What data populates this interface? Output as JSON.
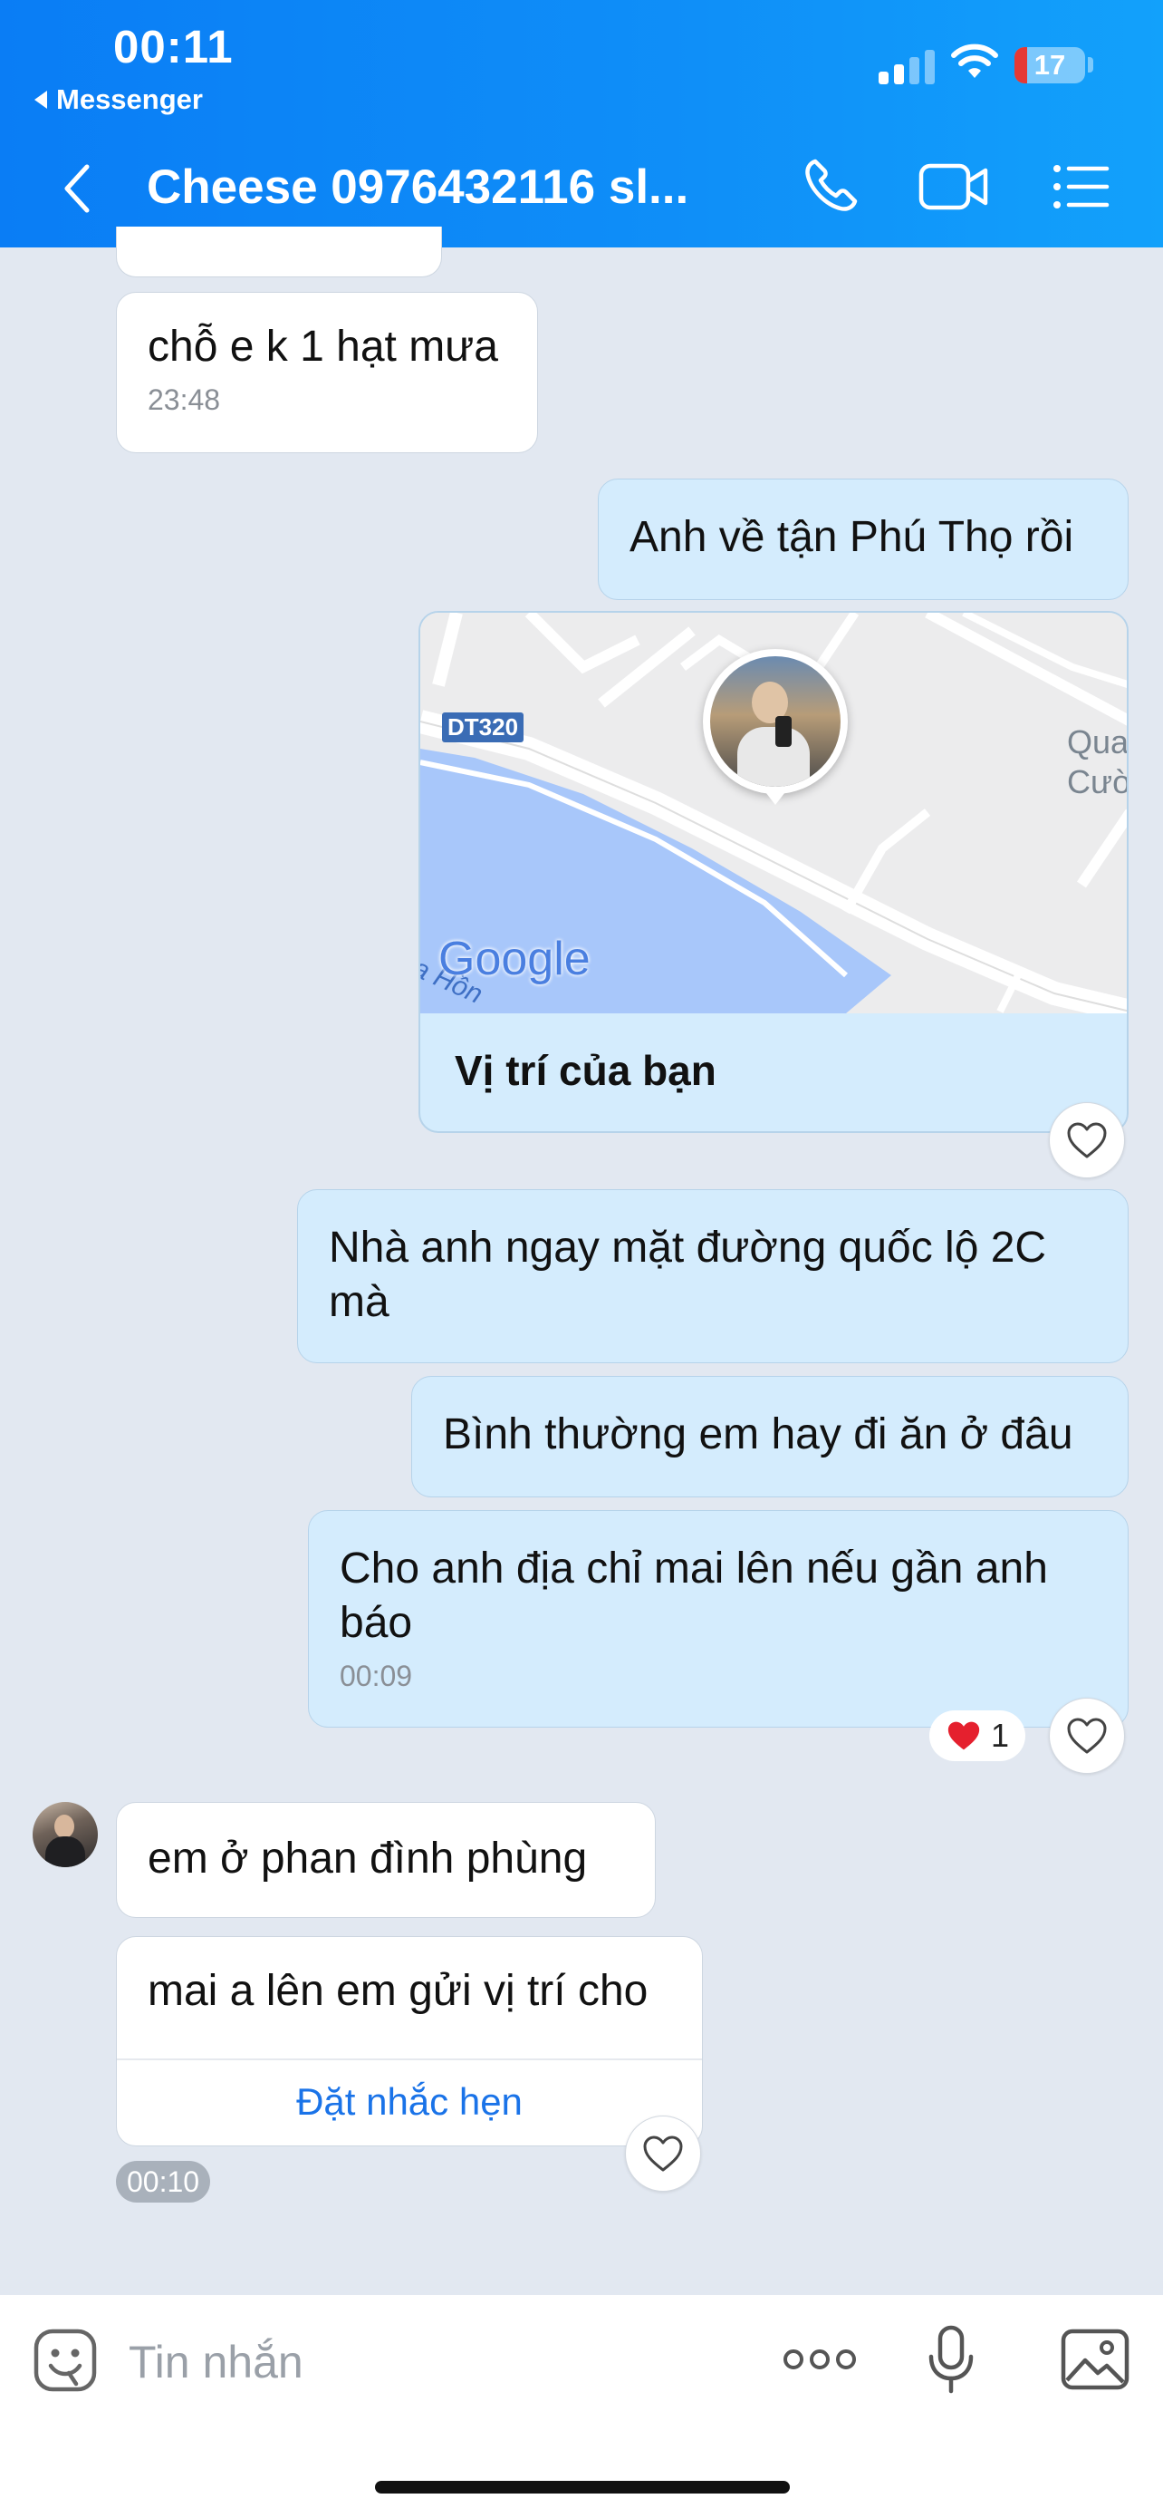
{
  "status_bar": {
    "time": "00:11",
    "back_app": "Messenger",
    "battery": "17"
  },
  "header": {
    "title": "Cheese 0976432116 sl...",
    "icons": [
      "back-icon",
      "phone-icon",
      "video-call-icon",
      "menu-list-icon"
    ]
  },
  "messages": {
    "m1": {
      "text": "chỗ e k 1 hạt mưa",
      "time": "23:48"
    },
    "m2": {
      "text": "Anh về tận Phú Thọ rồi"
    },
    "map": {
      "road_label": "DT320",
      "place_label_1": "Qua",
      "place_label_2": "Cườ",
      "water_label": "a Hồn",
      "brand": "Google",
      "caption": "Vị trí của bạn"
    },
    "m3": {
      "line1": "Nhà anh ngay mặt đường quốc lộ 2C",
      "line2": "mà"
    },
    "m4": {
      "text": "Bình thường em hay đi ăn ở đâu"
    },
    "m5": {
      "line1": "Cho anh địa chỉ mai lên nếu gần anh",
      "line2": "báo",
      "time": "00:09"
    },
    "reaction": {
      "count": "1"
    },
    "m6": {
      "text": "em ở phan đình phùng"
    },
    "m7": {
      "text": "mai a lên em gửi vị trí cho",
      "action": "Đặt nhắc hẹn"
    },
    "last_time": "00:10"
  },
  "composer": {
    "placeholder": "Tin nhắn"
  },
  "colors": {
    "header": "#0f8ff8",
    "my_bubble": "#d4ecfd",
    "background": "#e2e8f1",
    "link": "#1a73e8"
  }
}
